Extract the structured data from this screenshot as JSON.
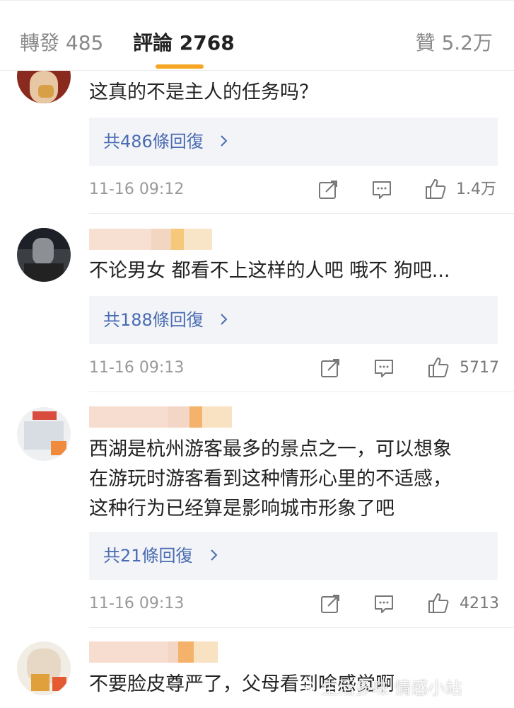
{
  "tabs": {
    "repost": "轉發 485",
    "comments": "評論 2768",
    "likes": "贊 5.2万"
  },
  "comments": [
    {
      "text": [
        "这真的不是主人的任务吗？"
      ],
      "reply_label": "共486條回復",
      "time": "11-16 09:12",
      "like_count": "1.4万"
    },
    {
      "text": [
        "不论男女 都看不上这样的人吧 哦不   狗吧..."
      ],
      "reply_label": "共188條回復",
      "time": "11-16 09:13",
      "like_count": "5717"
    },
    {
      "text": [
        "西湖是杭州游客最多的景点之一，可以想象",
        "在游玩时游客看到这种情形心里的不适感，",
        "这种行为已经算是影响城市形象了吧"
      ],
      "reply_label": "共21條回復",
      "time": "11-16 09:13",
      "like_count": "4213"
    },
    {
      "text": [
        "不要脸皮尊严了，父母看到啥感觉啊"
      ]
    }
  ],
  "watermark": "生活多味 情感小站",
  "colors": {
    "accent": "#f5a623",
    "reply_link": "#4a6bb3",
    "reply_bg": "#f2f4f7"
  },
  "icons": [
    "share-icon",
    "comment-icon",
    "thumbs-up-icon",
    "chevron-right-icon"
  ]
}
